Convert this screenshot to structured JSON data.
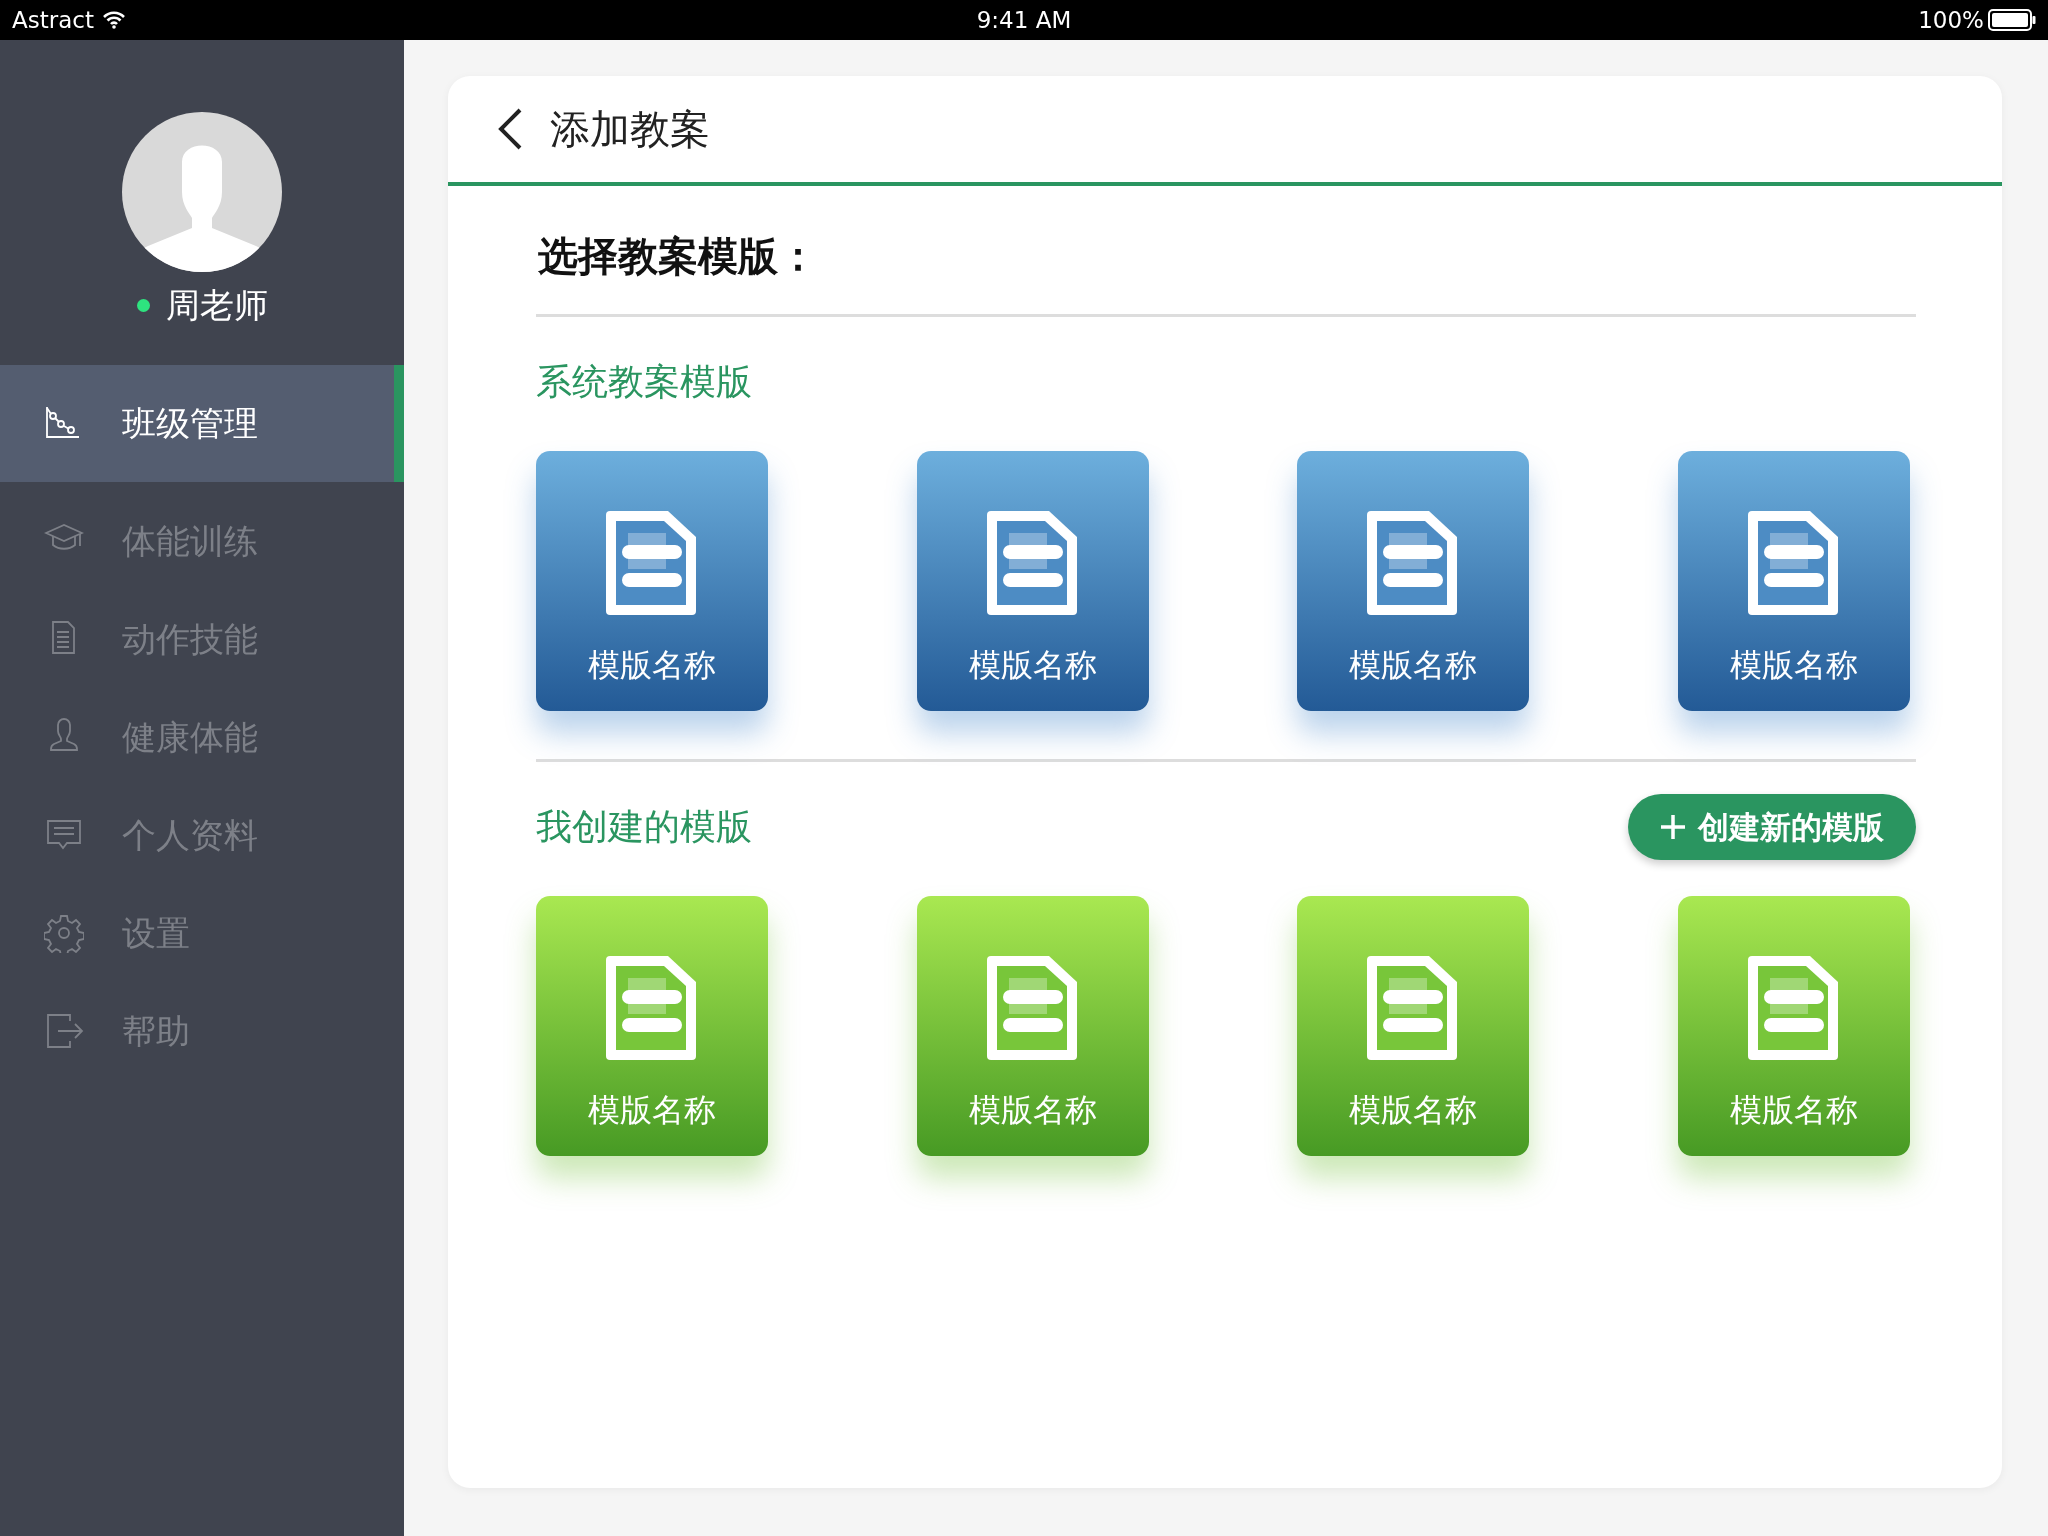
{
  "status_bar": {
    "carrier": "Astract",
    "time": "9:41 AM",
    "battery": "100%"
  },
  "sidebar": {
    "user": {
      "name": "周老师",
      "online": true
    },
    "items": [
      {
        "label": "班级管理",
        "kind": "chart",
        "selected": true
      },
      {
        "label": "体能训练",
        "kind": "cap",
        "selected": false
      },
      {
        "label": "动作技能",
        "kind": "document",
        "selected": false
      },
      {
        "label": "健康体能",
        "kind": "person",
        "selected": false
      },
      {
        "label": "个人资料",
        "kind": "message",
        "selected": false
      },
      {
        "label": "设置",
        "kind": "gear",
        "selected": false
      },
      {
        "label": "帮助",
        "kind": "exit",
        "selected": false
      }
    ]
  },
  "header": {
    "title": "添加教案"
  },
  "prompt": "选择教案模版：",
  "sections": [
    {
      "title": "系统教案模版",
      "kind": "system",
      "templates": [
        {
          "label": "模版名称"
        },
        {
          "label": "模版名称"
        },
        {
          "label": "模版名称"
        },
        {
          "label": "模版名称"
        }
      ]
    },
    {
      "title": "我创建的模版",
      "kind": "mine",
      "action": {
        "label": "创建新的模版"
      },
      "templates": [
        {
          "label": "模版名称"
        },
        {
          "label": "模版名称"
        },
        {
          "label": "模版名称"
        },
        {
          "label": "模版名称"
        }
      ]
    }
  ]
}
